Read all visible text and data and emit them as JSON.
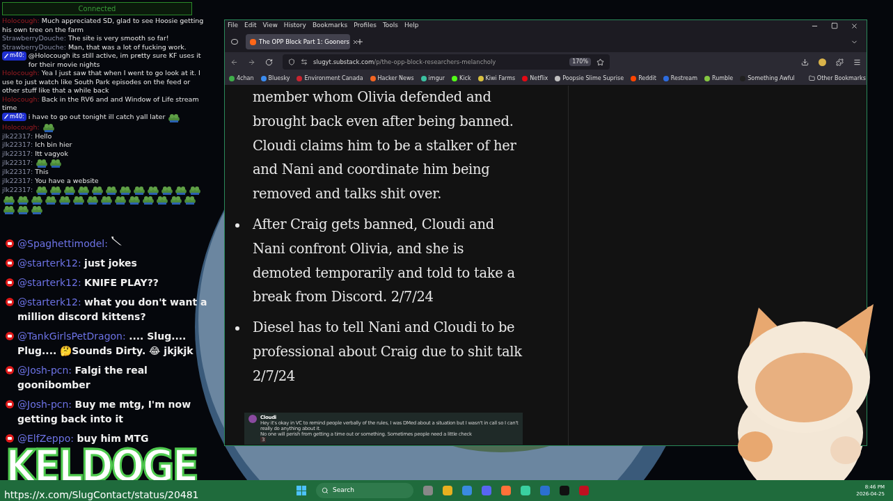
{
  "status": "Connected",
  "top_chat": [
    {
      "user": "Holocough:",
      "kind": "red",
      "text": "Much appreciated SD, glad to see Hoosie getting his own tree on the farm"
    },
    {
      "user": "StrawberryDouche:",
      "kind": "grey",
      "text": "The site is very smooth so far!"
    },
    {
      "user": "StrawberryDouche:",
      "kind": "grey",
      "text": "Man, that was a lot of fucking work."
    },
    {
      "user": "m40:",
      "kind": "badge",
      "text": "@Holocough its still active, im pretty sure KF uses it for their movie nights"
    },
    {
      "user": "Holocough:",
      "kind": "red",
      "text": "Yea I just saw that when I went to go look at it.  I use to just watch like South Park episodes on the feed or other stuff like that a while back"
    },
    {
      "user": "Holocough:",
      "kind": "red",
      "text": "Back in the RV6 and and Window of Life stream time"
    },
    {
      "user": "m40:",
      "kind": "badge",
      "text": "i have to go out tonight ill catch yall later",
      "emotes": [
        {
          "kind": "frog"
        }
      ]
    },
    {
      "user": "Holocough:",
      "kind": "red",
      "emotes": [
        {
          "kind": "frog"
        }
      ]
    },
    {
      "user": "jlk22317:",
      "kind": "grey",
      "text": "Hello"
    },
    {
      "user": "jlk22317:",
      "kind": "grey",
      "text": "Ich bin hier"
    },
    {
      "user": "jlk22317:",
      "kind": "grey",
      "text": "Itt vagyok"
    },
    {
      "user": "jlk22317:",
      "kind": "grey",
      "emotes": [
        {
          "kind": "frog"
        },
        {
          "kind": "frog"
        }
      ]
    },
    {
      "user": "jlk22317:",
      "kind": "grey",
      "text": "This"
    },
    {
      "user": "jlk22317:",
      "kind": "grey",
      "text": "You have a website"
    },
    {
      "user": "jlk22317:",
      "kind": "grey",
      "emotes": [
        {
          "kind": "frog"
        },
        {
          "kind": "frog"
        },
        {
          "kind": "frog"
        },
        {
          "kind": "frog"
        },
        {
          "kind": "frog"
        },
        {
          "kind": "frog"
        },
        {
          "kind": "frog"
        },
        {
          "kind": "frog"
        },
        {
          "kind": "frog"
        },
        {
          "kind": "frog"
        },
        {
          "kind": "frog"
        },
        {
          "kind": "frog"
        },
        {
          "kind": "frog"
        },
        {
          "kind": "frog"
        },
        {
          "kind": "frog"
        },
        {
          "kind": "frog"
        },
        {
          "kind": "frog"
        },
        {
          "kind": "frog"
        },
        {
          "kind": "frog"
        },
        {
          "kind": "frog"
        },
        {
          "kind": "frog"
        },
        {
          "kind": "frog"
        },
        {
          "kind": "frog"
        },
        {
          "kind": "frog"
        },
        {
          "kind": "frog"
        },
        {
          "kind": "frog"
        },
        {
          "kind": "frog"
        },
        {
          "kind": "frog"
        },
        {
          "kind": "frog"
        }
      ]
    }
  ],
  "yt_chat": [
    {
      "user": "@Spaghettimodel:",
      "emotes": [
        {
          "kind": "knife"
        }
      ]
    },
    {
      "user": "@starterk12:",
      "text": "just jokes"
    },
    {
      "user": "@starterk12:",
      "text": "KNIFE PLAY??"
    },
    {
      "user": "@starterk12:",
      "text": "what you don't want a million discord kittens?"
    },
    {
      "user": "@TankGirlsPetDragon:",
      "text": ".... Slug.... Plug.... 🤔Sounds Dirty. 😂 jkjkjk"
    },
    {
      "user": "@Josh-pcn:",
      "text": "Falgi the real goonibomber"
    },
    {
      "user": "@Josh-pcn:",
      "text": "Buy me mtg, I'm now getting back into it"
    },
    {
      "user": "@ElfZeppo:",
      "text": "buy him MTG"
    }
  ],
  "overlay_title": "KELDOGE",
  "overlay_link": "https://x.com/SlugContact/status/20481",
  "browser": {
    "menu": [
      "File",
      "Edit",
      "View",
      "History",
      "Bookmarks",
      "Profiles",
      "Tools",
      "Help"
    ],
    "tabs": [
      {
        "label": "The OPP Block Part 1: Gooners",
        "selected": true
      }
    ],
    "url_host": "slugyt.substack.com",
    "url_path": "/p/the-opp-block-researchers-melancholy",
    "zoom": "170%",
    "bookmarks": [
      {
        "label": "4chan",
        "color": "#3fae4a"
      },
      {
        "label": "Bluesky",
        "color": "#3b8cf0"
      },
      {
        "label": "Environment Canada",
        "color": "#c8242f"
      },
      {
        "label": "Hacker News",
        "color": "#f26522"
      },
      {
        "label": "imgur",
        "color": "#3bc0a0"
      },
      {
        "label": "Kick",
        "color": "#53fc18"
      },
      {
        "label": "Kiwi Farms",
        "color": "#d8c040"
      },
      {
        "label": "Netflix",
        "color": "#e50914"
      },
      {
        "label": "Poopsie Slime Suprise",
        "color": "#c0c0c0"
      },
      {
        "label": "Reddit",
        "color": "#ff4500"
      },
      {
        "label": "Restream",
        "color": "#2d6cdf"
      },
      {
        "label": "Rumble",
        "color": "#85c742"
      },
      {
        "label": "Something Awful",
        "color": "#202020"
      }
    ],
    "other_bookmarks": "Other Bookmarks",
    "article": [
      {
        "kind": "continuation",
        "text": "member whom Olivia defended and brought back even after being banned. Cloudi claims him to be a stalker of her and Nani and coordinate him being removed and talks shit over."
      },
      {
        "kind": "bullet",
        "text": "After Craig gets banned, Cloudi and Nani confront Olivia, and she is demoted temporarily and told to take a break from Discord. 2/7/24"
      },
      {
        "kind": "bullet",
        "text": "Diesel has to tell Nani and Cloudi to be professional about Craig due to shit talk 2/7/24"
      }
    ],
    "embed": {
      "name": "Cloudi",
      "lines": [
        "Hey it's okay in VC to remind people verbally of the rules, I was DMed about a situation but I wasn't in call so I can't really do anything about it.",
        "No one will perish from getting a time out or something. Sometimes people need a little check"
      ],
      "reaction": "3"
    }
  },
  "taskbar": {
    "search": "Search",
    "time": "8:46 PM",
    "date": "2026-04-25"
  }
}
